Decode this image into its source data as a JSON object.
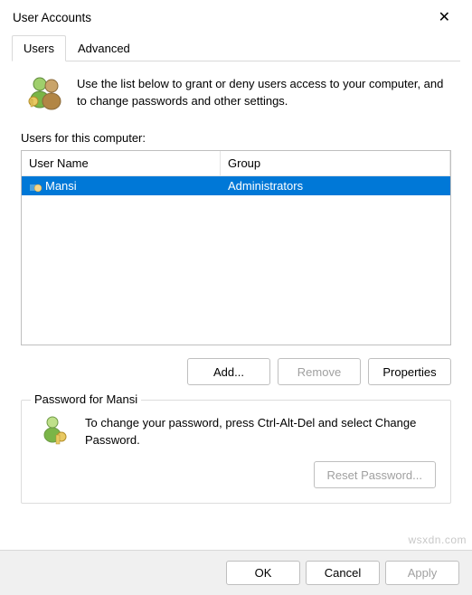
{
  "window": {
    "title": "User Accounts"
  },
  "tabs": {
    "users": "Users",
    "advanced": "Advanced"
  },
  "info_text": "Use the list below to grant or deny users access to your computer, and to change passwords and other settings.",
  "list_label": "Users for this computer:",
  "list_headers": {
    "user": "User Name",
    "group": "Group"
  },
  "list_rows": [
    {
      "user": "Mansi",
      "group": "Administrators"
    }
  ],
  "buttons": {
    "add": "Add...",
    "remove": "Remove",
    "properties": "Properties",
    "ok": "OK",
    "cancel": "Cancel",
    "apply": "Apply",
    "reset_password": "Reset Password..."
  },
  "password_section": {
    "legend": "Password for Mansi",
    "text": "To change your password, press Ctrl-Alt-Del and select Change Password."
  },
  "watermark": "wsxdn.com"
}
